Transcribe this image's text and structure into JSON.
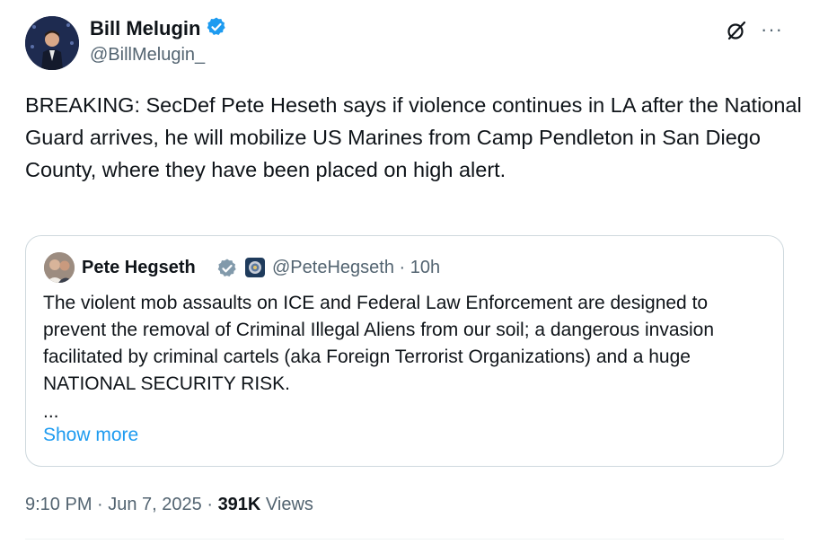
{
  "author": {
    "name": "Bill Melugin",
    "handle": "@BillMelugin_",
    "verified": true
  },
  "tweet": {
    "text": "BREAKING: SecDef Pete Heseth says if violence continues in LA after the National Guard arrives, he will mobilize US Marines from Camp Pendleton in San Diego County, where they have been placed on high alert."
  },
  "quote": {
    "name": "Pete Hegseth",
    "handle": "@PeteHegseth",
    "time": "· 10h",
    "text": "The violent mob assaults on ICE and Federal Law Enforcement are designed to prevent the removal of Criminal Illegal Aliens from our soil; a dangerous invasion facilitated by criminal cartels (aka Foreign Terrorist Organizations) and a huge NATIONAL SECURITY RISK.",
    "ellipsis": "...",
    "show_more": "Show more"
  },
  "meta": {
    "datetime": "9:10 PM · Jun 7, 2025 · ",
    "views_count": "391K",
    "views_label": " Views"
  },
  "icons": {
    "grok": "grok-icon",
    "more": "more-icon",
    "verified": "verified-badge-icon",
    "affiliation": "government-affiliation-icon"
  },
  "colors": {
    "accent": "#1d9bf0",
    "secondary_text": "#536471",
    "border": "#cfd9de",
    "verified_gray": "#829aab"
  }
}
